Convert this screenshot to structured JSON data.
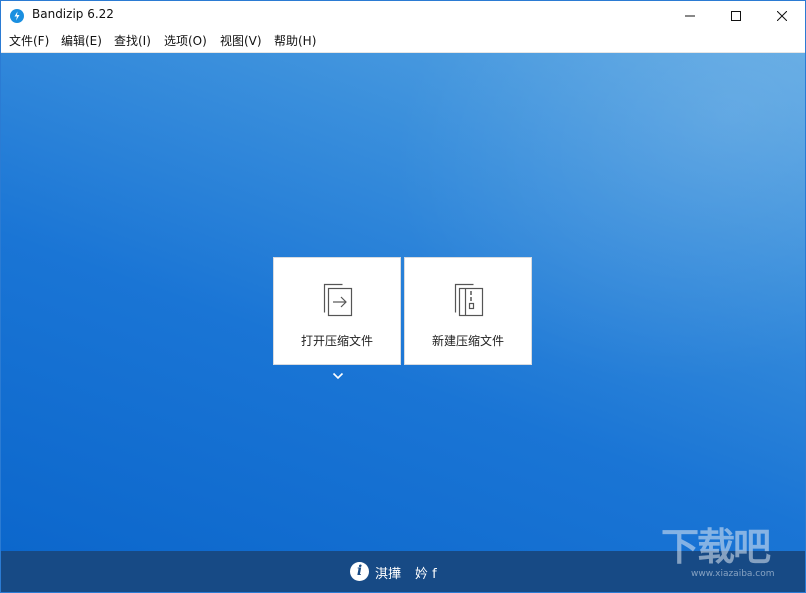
{
  "window": {
    "title": "Bandizip 6.22",
    "controls": {
      "minimize": "minimize-icon",
      "maximize": "maximize-icon",
      "close": "close-icon"
    }
  },
  "menu": {
    "items": [
      {
        "label": "文件(F)"
      },
      {
        "label": "编辑(E)"
      },
      {
        "label": "查找(I)"
      },
      {
        "label": "选项(O)"
      },
      {
        "label": "视图(V)"
      },
      {
        "label": "帮助(H)"
      }
    ]
  },
  "actions": {
    "open_archive": {
      "label": "打开压缩文件",
      "icon": "open-archive-icon"
    },
    "new_archive": {
      "label": "新建压缩文件",
      "icon": "new-archive-icon"
    },
    "more": {
      "icon": "chevron-down-icon"
    }
  },
  "status": {
    "icon": "info-icon",
    "text_part1": "淇撶",
    "text_part2": "妗 f"
  },
  "watermark": {
    "text": "下载吧",
    "url": "www.xiazaiba.com"
  },
  "colors": {
    "accent": "#1a8fe0",
    "background_top": "#5aa6e2",
    "background_bottom": "#0c67cc",
    "statusbar": "#174a85"
  }
}
